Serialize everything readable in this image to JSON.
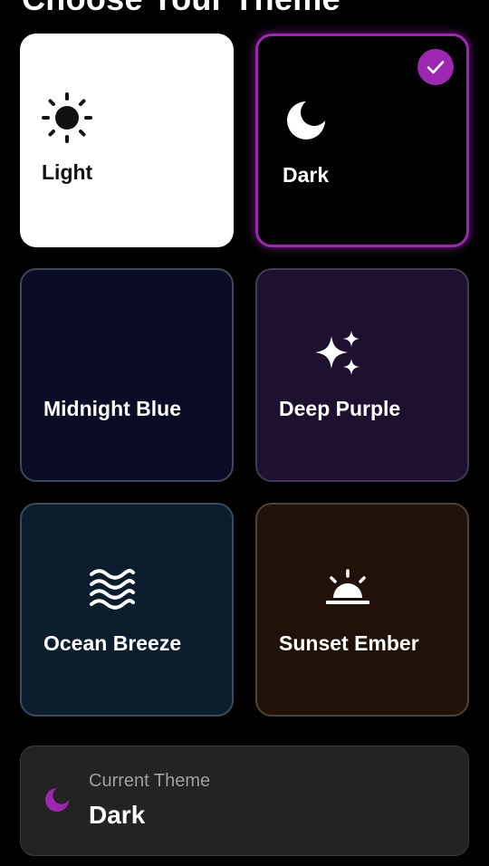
{
  "header": {
    "title": "Choose Your Theme"
  },
  "themes": [
    {
      "name": "Light",
      "icon": "sun-icon",
      "background": "#ffffff",
      "selected": false
    },
    {
      "name": "Dark",
      "icon": "moon-icon",
      "background": "#000000",
      "selected": true
    },
    {
      "name": "Midnight Blue",
      "icon": "crescent-moon-icon",
      "background": "#0b0d26",
      "selected": false
    },
    {
      "name": "Deep Purple",
      "icon": "sparkles-icon",
      "background": "#1e1130",
      "selected": false
    },
    {
      "name": "Ocean Breeze",
      "icon": "waves-icon",
      "background": "#0c1e2d",
      "selected": false
    },
    {
      "name": "Sunset Ember",
      "icon": "sunset-icon",
      "background": "#211209",
      "selected": false
    }
  ],
  "current_theme": {
    "label": "Current Theme",
    "value": "Dark",
    "icon": "moon-icon"
  },
  "colors": {
    "accent": "#9c27b0",
    "page_background": "#000000",
    "panel_background": "#232323"
  }
}
